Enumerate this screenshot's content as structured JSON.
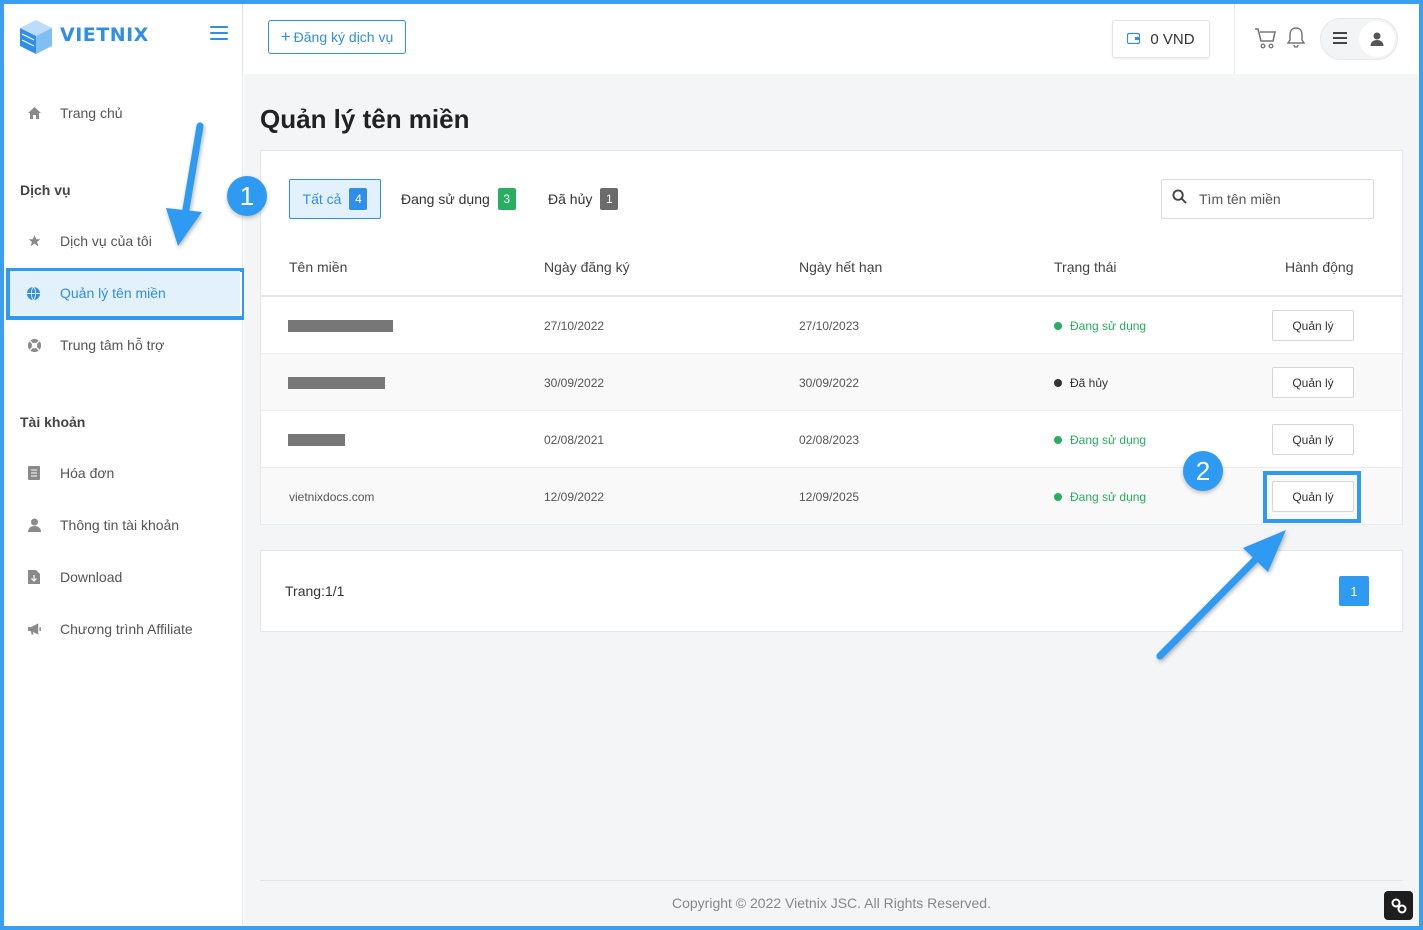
{
  "brand": {
    "logo_text": "VIETNIX"
  },
  "header": {
    "register_label": "Đăng ký dịch vụ",
    "wallet_label": "0 VND"
  },
  "sidebar": {
    "home": "Trang chủ",
    "services_section": "Dịch vụ",
    "my_services": "Dịch vụ của tôi",
    "domains": "Quản lý tên miền",
    "support": "Trung tâm hỗ trợ",
    "account_section": "Tài khoản",
    "invoices": "Hóa đơn",
    "account_info": "Thông tin tài khoản",
    "download": "Download",
    "affiliate": "Chương trình Affiliate"
  },
  "main": {
    "title": "Quản lý tên miền",
    "tabs": [
      {
        "label": "Tất cả",
        "count": "4",
        "color": "#2f8ee8"
      },
      {
        "label": "Đang sử dụng",
        "count": "3",
        "color": "#27ae60"
      },
      {
        "label": "Đã hủy",
        "count": "1",
        "color": "#6b6b6b"
      }
    ],
    "search_placeholder": "Tìm tên miền",
    "columns": [
      "Tên miền",
      "Ngày đăng ký",
      "Ngày hết hạn",
      "Trạng thái",
      "Hành động"
    ],
    "rows": [
      {
        "domain": "",
        "registered": "27/10/2022",
        "expires": "27/10/2023",
        "status": "Đang sử dụng",
        "status_color": "#27ae60",
        "action": "Quản lý"
      },
      {
        "domain": "",
        "registered": "30/09/2022",
        "expires": "30/09/2022",
        "status": "Đã hủy",
        "status_color": "#333333",
        "action": "Quản lý"
      },
      {
        "domain": "",
        "registered": "02/08/2021",
        "expires": "02/08/2023",
        "status": "Đang sử dụng",
        "status_color": "#27ae60",
        "action": "Quản lý"
      },
      {
        "domain": "vietnixdocs.com",
        "registered": "12/09/2022",
        "expires": "12/09/2025",
        "status": "Đang sử dụng",
        "status_color": "#27ae60",
        "action": "Quản lý"
      }
    ],
    "pagination_text": "Trang:1/1",
    "current_page": "1"
  },
  "footer": {
    "copyright": "Copyright © 2022 Vietnix JSC. All Rights Reserved."
  },
  "annotations": {
    "step1": "1",
    "step2": "2"
  },
  "colors": {
    "accent": "#2f8ee8",
    "success": "#27ae60",
    "muted": "#6b6b6b"
  }
}
